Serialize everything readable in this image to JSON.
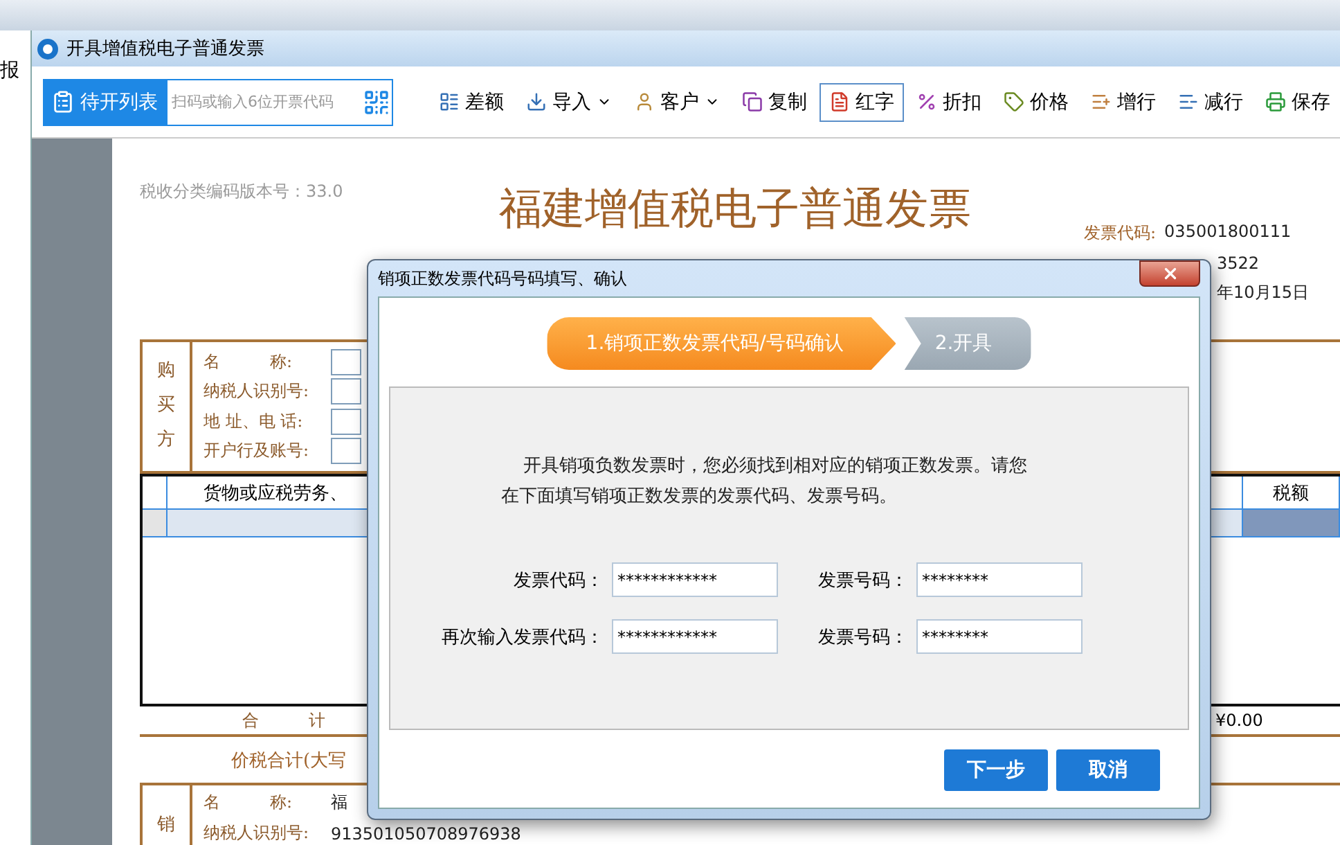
{
  "side_label": "报",
  "window": {
    "title": "开具增值税电子普通发票"
  },
  "toolbar": {
    "list_button": "待开列表",
    "search": {
      "placeholder": "扫码或输入6位开票代码"
    },
    "actions": [
      {
        "kind": "diff",
        "label": "差额",
        "dropdown": false,
        "selected": false
      },
      {
        "kind": "import",
        "label": "导入",
        "dropdown": true,
        "selected": false
      },
      {
        "kind": "customer",
        "label": "客户",
        "dropdown": true,
        "selected": false
      },
      {
        "kind": "copy",
        "label": "复制",
        "dropdown": false,
        "selected": false
      },
      {
        "kind": "red",
        "label": "红字",
        "dropdown": false,
        "selected": true
      },
      {
        "kind": "discount",
        "label": "折扣",
        "dropdown": false,
        "selected": false
      },
      {
        "kind": "price",
        "label": "价格",
        "dropdown": false,
        "selected": false
      },
      {
        "kind": "addrow",
        "label": "增行",
        "dropdown": false,
        "selected": false
      },
      {
        "kind": "delrow",
        "label": "减行",
        "dropdown": false,
        "selected": false
      },
      {
        "kind": "save",
        "label": "保存",
        "dropdown": false,
        "selected": false
      }
    ]
  },
  "invoice": {
    "version": "税收分类编码版本号：33.0",
    "title": "福建增值税电子普通发票",
    "info": [
      {
        "label": "发票代码:",
        "value": "035001800111"
      },
      {
        "value": "3522"
      },
      {
        "value": "年10月15日"
      }
    ],
    "buyer": {
      "side": "购买方",
      "labels": [
        "名　　　称:",
        "纳税人识别号:",
        "地 址、电 话:",
        "开户行及账号:"
      ]
    },
    "goods": {
      "header": "货物或应税劳务、",
      "tax_header": "税额"
    },
    "total": {
      "label": "合　　　计",
      "value": "¥0.00"
    },
    "grand_total": {
      "label": "价税合计(大写"
    },
    "seller": {
      "side": "销",
      "rows": [
        {
          "label": "名　　　称:",
          "value": "福"
        },
        {
          "label": "纳税人识别号:",
          "value": "913501050708976938"
        }
      ]
    }
  },
  "dialog": {
    "title": "销项正数发票代码号码填写、确认",
    "steps": [
      {
        "label": "1.销项正数发票代码/号码确认",
        "selected": true
      },
      {
        "label": "2.开具",
        "selected": false
      }
    ],
    "message": "开具销项负数发票时，您必须找到相对应的销项正数发票。请您在下面填写销项正数发票的发票代码、发票号码。",
    "fields": [
      {
        "label": "发票代码：",
        "value": "************"
      },
      {
        "label": "发票号码：",
        "value": "********"
      },
      {
        "label": "再次输入发票代码：",
        "value": "************"
      },
      {
        "label": "发票号码：",
        "value": "********"
      }
    ],
    "buttons": [
      "下一步",
      "取消"
    ]
  }
}
